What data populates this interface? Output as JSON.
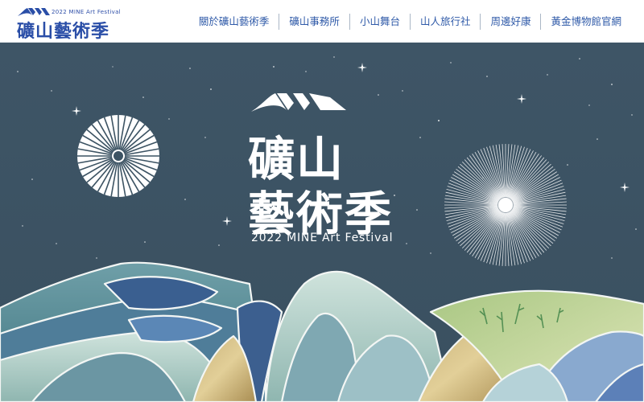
{
  "header": {
    "logo": {
      "subtitle": "2022 MINE Art Festival",
      "title": "礦山藝術季"
    },
    "nav": [
      {
        "label": "關於礦山藝術季"
      },
      {
        "label": "礦山事務所"
      },
      {
        "label": "小山舞台"
      },
      {
        "label": "山人旅行社"
      },
      {
        "label": "周邊好康"
      },
      {
        "label": "黃金博物館官網"
      }
    ]
  },
  "hero": {
    "title_line1": "礦山",
    "title_line2": "藝術季",
    "subtitle": "2022 MINE Art Festival"
  },
  "colors": {
    "brand_blue": "#2a4ea7",
    "sky": "#3c5363",
    "white": "#ffffff"
  }
}
